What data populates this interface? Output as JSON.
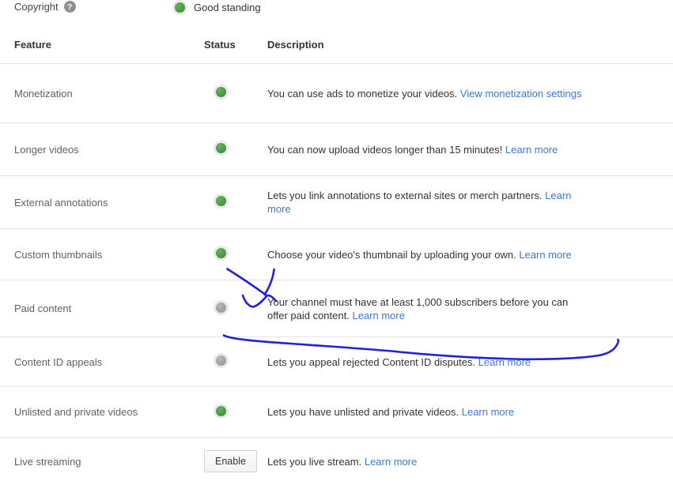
{
  "colors": {
    "status_green": "#47953f",
    "status_gray": "#9c9c9c",
    "link_blue": "#3c78d8",
    "pen_blue": "#2020dd",
    "divider": "#e4e4e4"
  },
  "header_bar": {
    "copyright_label": "Copyright",
    "help_glyph": "?",
    "status_label": "Good standing"
  },
  "table": {
    "headers": {
      "feature": "Feature",
      "status": "Status",
      "description": "Description"
    },
    "rows": [
      {
        "feature": "Monetization",
        "status": "enabled",
        "description": "You can use ads to monetize your videos.",
        "link": "View monetization settings"
      },
      {
        "feature": "Longer videos",
        "status": "enabled",
        "description": "You can now upload videos longer than 15 minutes!",
        "link": "Learn more"
      },
      {
        "feature": "External annotations",
        "status": "enabled",
        "description": "Lets you link annotations to external sites or merch partners.",
        "link": "Learn more"
      },
      {
        "feature": "Custom thumbnails",
        "status": "enabled",
        "description": "Choose your video's thumbnail by uploading your own.",
        "link": "Learn more"
      },
      {
        "feature": "Paid content",
        "status": "disabled",
        "description": "Your channel must have at least 1,000 subscribers before you can offer paid content.",
        "link": "Learn more"
      },
      {
        "feature": "Content ID appeals",
        "status": "disabled",
        "description": "Lets you appeal rejected Content ID disputes.",
        "link": "Learn more"
      },
      {
        "feature": "Unlisted and private videos",
        "status": "enabled",
        "description": "Lets you have unlisted and private videos.",
        "link": "Learn more"
      },
      {
        "feature": "Live streaming",
        "status": "button",
        "button_label": "Enable",
        "description": "Lets you live stream.",
        "link": "Learn more"
      }
    ]
  },
  "annotation": {
    "description": "hand-drawn blue pen marks",
    "paths": [
      "M287.5,340.5 C301,349 324,364.5 336.5,373.5",
      "M346.5,341 C345.5,351 341,363.5 334.5,373",
      "M307,374 C309.5,382 314.5,387.5 319.5,388.5 C324.5,388 331.5,381.5 336.5,375.5 C340,371.5 345,376.5 349,381",
      "M283,424.5 C291,429.5 330,432.5 368,435 C430,439.5 470,442 505,445.5 C545,449.5 600,453 650,454.5 C695,455.5 735,453.5 757,450 C768,448 776,443.5 779.5,437.5 C782,433.5 782.5,431.5 781.5,430"
    ]
  }
}
